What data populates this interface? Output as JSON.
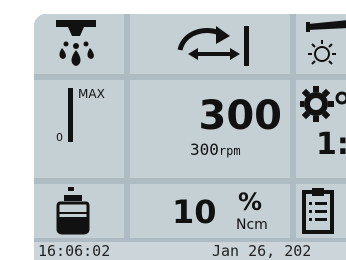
{
  "header": {
    "coolant_icon": "irrigation-spray-icon",
    "direction_icon": "rotation-direction-forward-reverse-icon",
    "light_icon": "handpiece-light-icon"
  },
  "speed": {
    "bar_top_label": "MAX",
    "bar_bottom_label": "0",
    "value": "300",
    "sub_value": "300",
    "sub_unit": "rpm",
    "gear_icon": "gear-ratio-icon",
    "ratio_partial": "1:"
  },
  "torque": {
    "bottle_icon": "irrigation-bottle-icon",
    "value": "10",
    "unit_top": "%",
    "unit_bottom": "Ncm",
    "clipboard_icon": "program-clipboard-icon"
  },
  "status_bar": {
    "time": "16:06:02",
    "date": "Jan 26, 202"
  },
  "colors": {
    "screen_bg": "#aebbc2",
    "cell_bg": "#c5d0d5",
    "ink": "#111111"
  }
}
